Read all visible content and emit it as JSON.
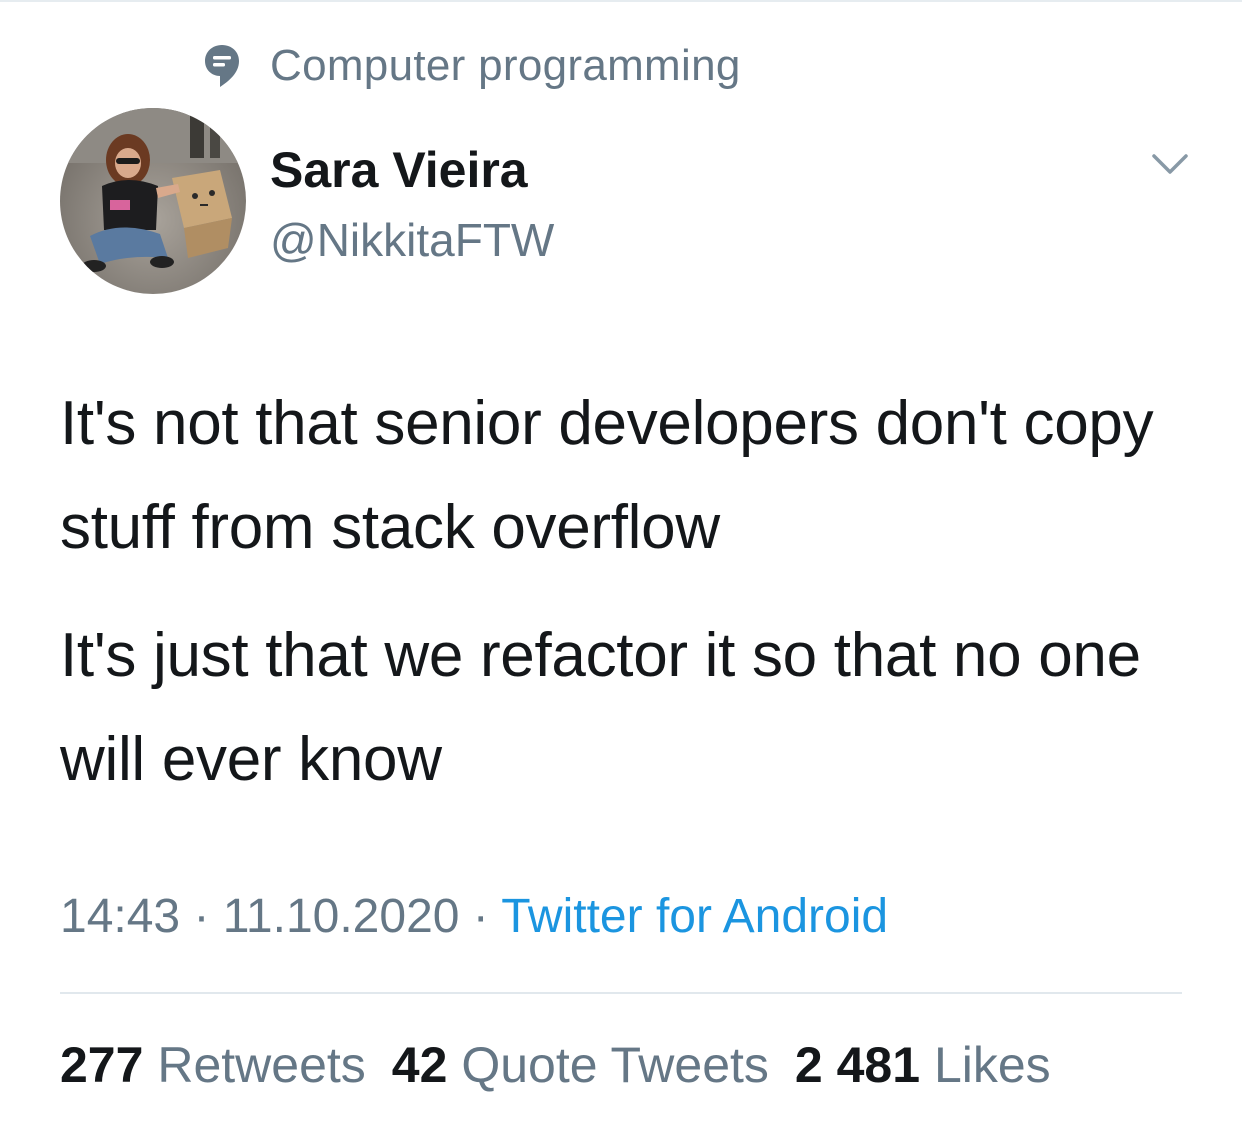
{
  "context": {
    "icon": "speech-bubble-topic-icon",
    "label": "Computer programming"
  },
  "user": {
    "avatar": "profile-photo",
    "display_name": "Sara Vieira",
    "handle": "@NikkitaFTW"
  },
  "menu": {
    "icon": "chevron-down-icon"
  },
  "tweet": {
    "paragraphs": [
      "It's not that senior developers don't copy stuff from stack overflow",
      "It's just that we refactor it so that no one will ever know"
    ]
  },
  "meta": {
    "time": "14:43",
    "sep1": " · ",
    "date": "11.10.2020",
    "sep2": " · ",
    "source": "Twitter for Android"
  },
  "stats": {
    "retweets_count": "277",
    "retweets_label": "Retweets",
    "quotes_count": "42",
    "quotes_label": "Quote Tweets",
    "likes_count": "2 481",
    "likes_label": "Likes"
  },
  "colors": {
    "text_primary": "#14171a",
    "text_secondary": "#657786",
    "link": "#1b95e0",
    "divider": "#e1e8ed"
  }
}
